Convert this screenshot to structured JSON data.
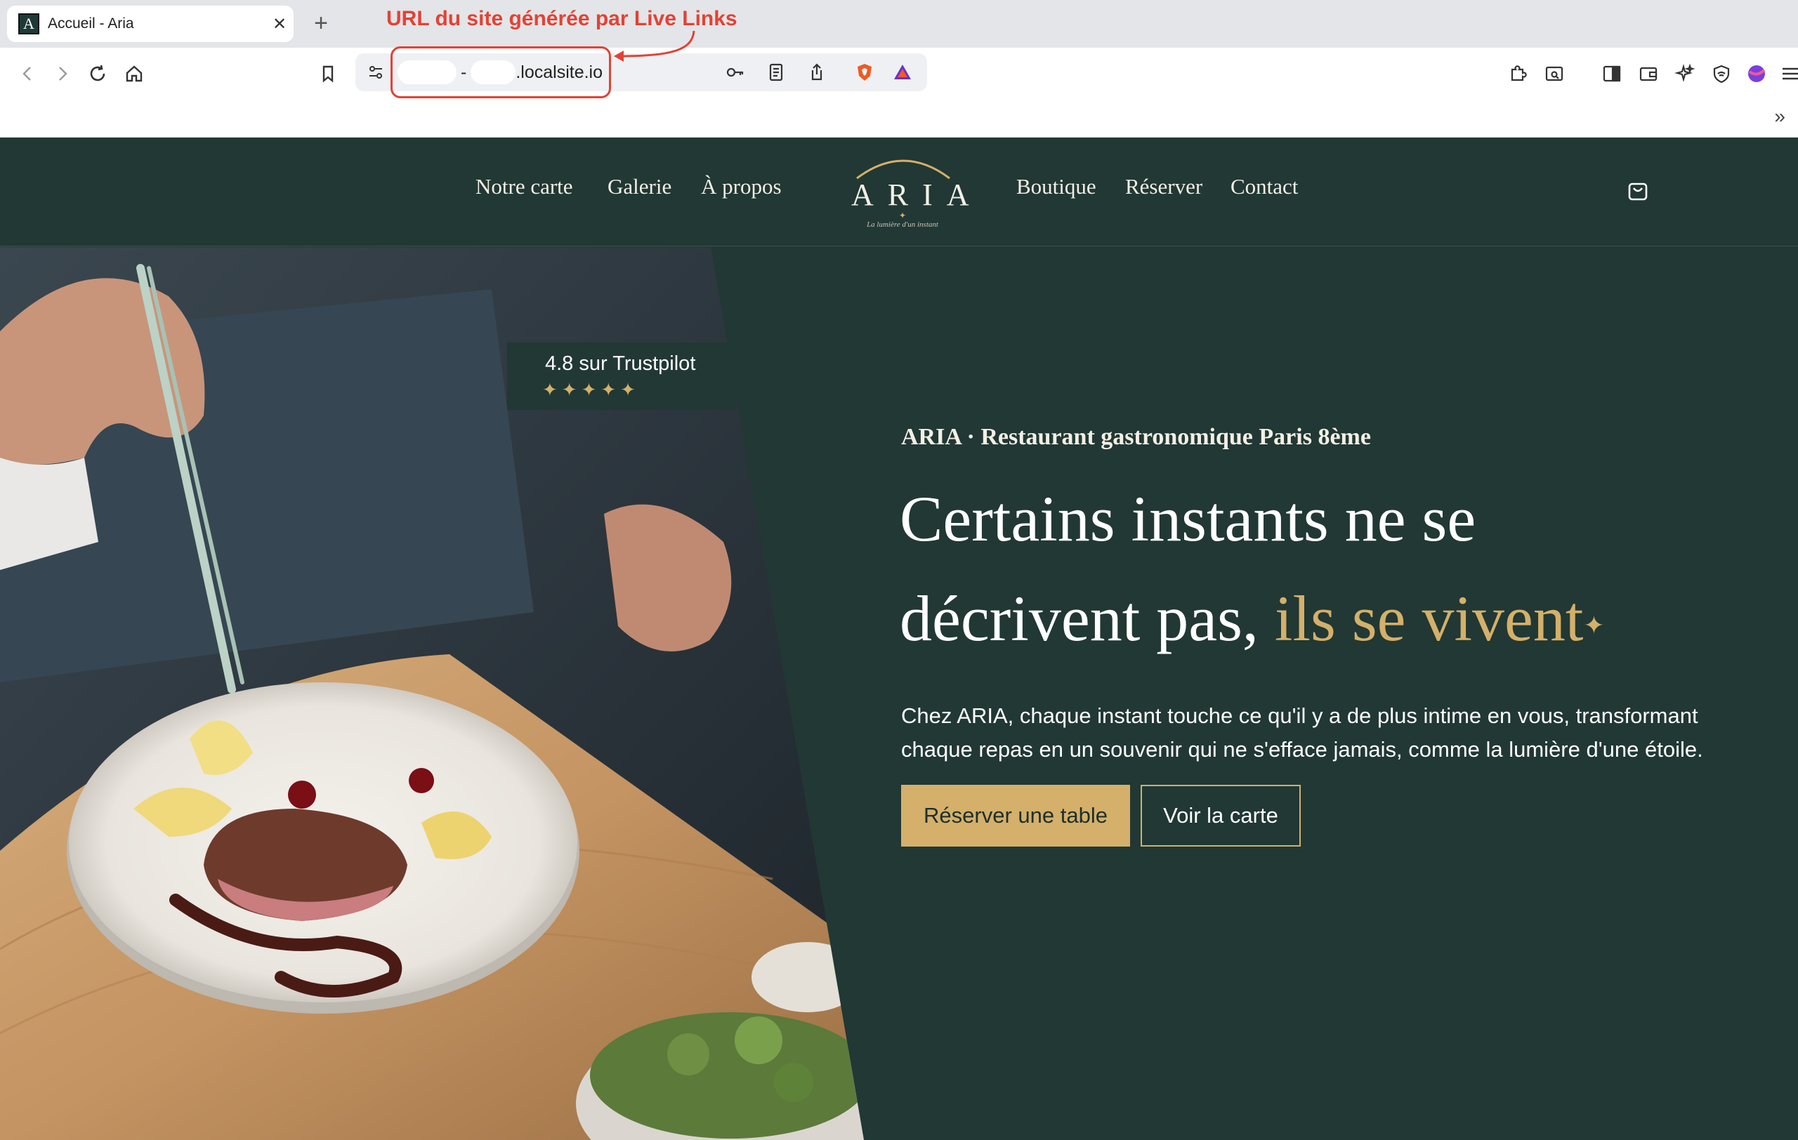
{
  "browser": {
    "tab_title": "Accueil - Aria",
    "tab_favicon_letter": "A",
    "tab_close": "✕",
    "new_tab": "+",
    "url_dash": "-",
    "url_suffix": ".localsite.io",
    "more_bookmarks": "»"
  },
  "annotation": {
    "text": "URL du site générée par Live Links",
    "color": "#e34234"
  },
  "nav": {
    "left_links": [
      "Notre carte",
      "Galerie",
      "À propos"
    ],
    "right_links": [
      "Boutique",
      "Réserver",
      "Contact"
    ],
    "logo_text": "ARIA",
    "logo_star": "✦",
    "logo_tagline": "La lumière d'un instant"
  },
  "hero": {
    "trust_text": "4.8 sur Trustpilot",
    "trust_stars": "✦✦✦✦✦",
    "subtitle": "ARIA · Restaurant gastronomique Paris 8ème",
    "headline_line1": "Certains instants ne se",
    "headline_line2_white": "décrivent pas, ",
    "headline_line2_gold": "ils se vivent",
    "headline_star": "✦",
    "body": "Chez ARIA, chaque instant touche ce qu'il y a de plus intime en vous, transformant chaque repas en un souvenir qui ne s'efface jamais, comme la lumière d'une étoile.",
    "cta_primary": "Réserver une table",
    "cta_secondary": "Voir la carte"
  },
  "colors": {
    "site_bg": "#213834",
    "gold": "#d4b06a",
    "text_light": "#f3efe6"
  },
  "icons": {
    "toolbar_left": [
      "back-icon",
      "forward-icon",
      "reload-icon",
      "home-icon",
      "bookmark-icon"
    ],
    "omnibox": [
      "site-settings-icon",
      "key-icon",
      "reader-icon",
      "share-icon",
      "brave-shields-icon",
      "brave-rewards-icon"
    ],
    "toolbar_right": [
      "extensions-icon",
      "tab-search-icon",
      "sidebar-icon",
      "wallet-icon",
      "leo-ai-icon",
      "vpn-icon",
      "profile-icon",
      "menu-icon"
    ],
    "site": [
      "cart-icon"
    ]
  }
}
